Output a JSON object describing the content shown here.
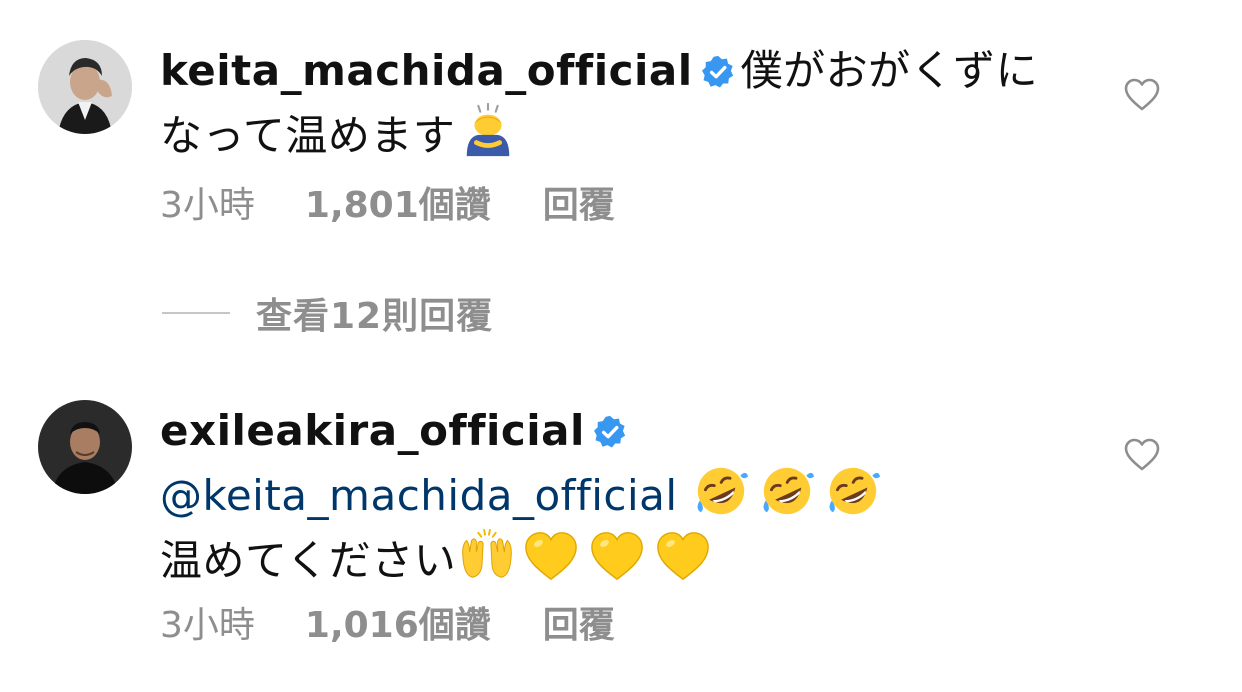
{
  "comments": [
    {
      "username": "keita_machida_official",
      "verified": true,
      "text_line1": "僕がおがくずに",
      "text_line2": "なって温めます",
      "emoji": [
        "person-bowing"
      ],
      "time": "3小時",
      "likes": "1,801個讚",
      "reply_label": "回覆",
      "view_replies": "查看12則回覆"
    },
    {
      "username": "exileakira_official",
      "verified": true,
      "mention": "@keita_machida_official",
      "mention_emoji": [
        "rolling-on-floor-laughing",
        "rolling-on-floor-laughing",
        "rolling-on-floor-laughing"
      ],
      "text": "温めてください",
      "text_emoji": [
        "raising-hands",
        "yellow-heart",
        "yellow-heart",
        "yellow-heart"
      ],
      "time": "3小時",
      "likes": "1,016個讚",
      "reply_label": "回覆"
    }
  ],
  "colors": {
    "text": "#111111",
    "secondary": "#8e8e8e",
    "verified": "#3897f0",
    "mention": "#00376b",
    "divider": "#c7c7c7"
  }
}
